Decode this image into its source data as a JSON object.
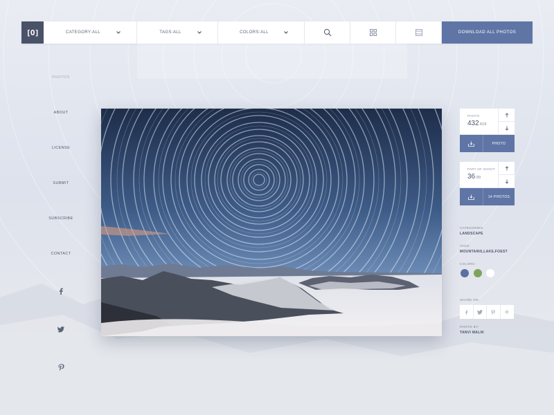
{
  "header": {
    "logo_text": "[O]",
    "category_label": "CATEGORY:ALL",
    "tags_label": "TAGS:ALL",
    "colors_label": "COLORS:ALL",
    "download_all_label": "DOWNLOAD ALL PHOTOS"
  },
  "nav": {
    "items": [
      {
        "label": "PHOTOS",
        "active": true
      },
      {
        "label": "ABOUT"
      },
      {
        "label": "LICENSE"
      },
      {
        "label": "SUBMIT"
      },
      {
        "label": "SUBSCRIBE"
      },
      {
        "label": "CONTACT"
      }
    ],
    "social_icons": [
      "facebook-icon",
      "twitter-icon",
      "pinterest-icon"
    ]
  },
  "photo_card": {
    "label": "PHOTO",
    "number": "432",
    "total": "/619",
    "button_label": "PHOTO"
  },
  "set_card": {
    "label": "PART OF SHOOT",
    "number": "36",
    "total": "/39",
    "button_label": "14 PHOTOS"
  },
  "details": {
    "categories_label": "CATEGORIES:",
    "categories_value": "LANDSCAPE",
    "tags_label": "TAGS:",
    "tags_value": "MOUNTAINS,LAKE,FOEST",
    "colors_label": "COLORS:",
    "colors": [
      "#5c6fa2",
      "#7ea45c",
      "#ffffff"
    ],
    "share_label": "SHARE ON:",
    "share_icons": [
      "facebook-icon",
      "twitter-icon",
      "pinterest-icon",
      "plus-icon"
    ],
    "photo_by_label": "PHOTO BY:",
    "photo_by_value": "TANVI MALIK"
  },
  "theme": {
    "accent": "#5f75a6",
    "logo_bg": "#4a5268"
  }
}
